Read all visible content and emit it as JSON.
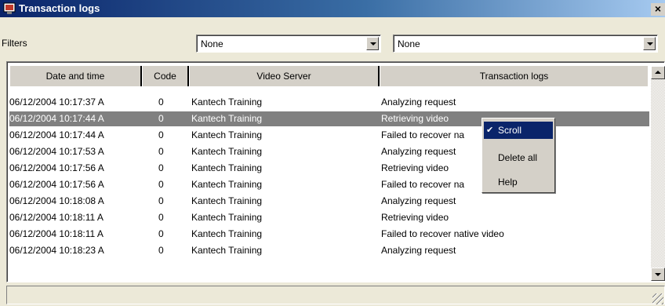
{
  "window": {
    "title": "Transaction logs",
    "close_label": "×"
  },
  "filters": {
    "label": "Filters",
    "filter1_value": "None",
    "filter2_value": "None"
  },
  "table": {
    "columns": [
      "Date and time",
      "Code",
      "Video Server",
      "Transaction logs"
    ],
    "rows": [
      {
        "datetime": "06/12/2004 10:17:37 A",
        "code": "0",
        "server": "Kantech Training",
        "log": "Analyzing request"
      },
      {
        "datetime": "06/12/2004 10:17:44 A",
        "code": "0",
        "server": "Kantech Training",
        "log": "Retrieving video"
      },
      {
        "datetime": "06/12/2004 10:17:44 A",
        "code": "0",
        "server": "Kantech Training",
        "log": "Failed to recover na"
      },
      {
        "datetime": "06/12/2004 10:17:53 A",
        "code": "0",
        "server": "Kantech Training",
        "log": "Analyzing request"
      },
      {
        "datetime": "06/12/2004 10:17:56 A",
        "code": "0",
        "server": "Kantech Training",
        "log": "Retrieving video"
      },
      {
        "datetime": "06/12/2004 10:17:56 A",
        "code": "0",
        "server": "Kantech Training",
        "log": "Failed to recover na"
      },
      {
        "datetime": "06/12/2004 10:18:08 A",
        "code": "0",
        "server": "Kantech Training",
        "log": "Analyzing request"
      },
      {
        "datetime": "06/12/2004 10:18:11 A",
        "code": "0",
        "server": "Kantech Training",
        "log": "Retrieving video"
      },
      {
        "datetime": "06/12/2004 10:18:11 A",
        "code": "0",
        "server": "Kantech Training",
        "log": "Failed to recover native video"
      },
      {
        "datetime": "06/12/2004 10:18:23 A",
        "code": "0",
        "server": "Kantech Training",
        "log": "Analyzing request"
      }
    ],
    "selected_row": 1
  },
  "context_menu": {
    "items": [
      {
        "label": "Scroll",
        "checked": true
      },
      {
        "label": "Delete all",
        "checked": false
      },
      {
        "label": "Help",
        "checked": false
      }
    ],
    "check_glyph": "✔"
  },
  "colors": {
    "titlebar": "#0a246a",
    "selection": "#808080",
    "menu_highlight": "#0a246a"
  }
}
